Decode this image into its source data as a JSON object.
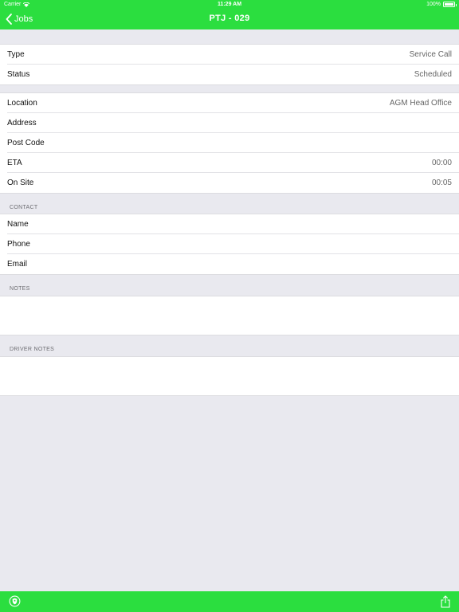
{
  "status_bar": {
    "carrier": "Carrier",
    "time": "11:29 AM",
    "battery": "100%"
  },
  "nav": {
    "back_label": "Jobs",
    "title": "PTJ - 029"
  },
  "job": {
    "type": {
      "label": "Type",
      "value": "Service Call"
    },
    "status": {
      "label": "Status",
      "value": "Scheduled"
    }
  },
  "site": {
    "location": {
      "label": "Location",
      "value": "AGM Head Office"
    },
    "address": {
      "label": "Address",
      "value": ""
    },
    "post_code": {
      "label": "Post Code",
      "value": ""
    },
    "eta": {
      "label": "ETA",
      "value": "00:00"
    },
    "on_site": {
      "label": "On Site",
      "value": "00:05"
    }
  },
  "contact": {
    "header": "CONTACT",
    "name": {
      "label": "Name",
      "value": ""
    },
    "phone": {
      "label": "Phone",
      "value": ""
    },
    "email": {
      "label": "Email",
      "value": ""
    }
  },
  "notes": {
    "header": "NOTES",
    "text": ""
  },
  "driver_notes": {
    "header": "DRIVER NOTES",
    "text": ""
  },
  "toolbar": {
    "left_icon": "shield-icon",
    "right_icon": "share-icon"
  },
  "colors": {
    "accent": "#2bde3f",
    "background": "#e9e9ef"
  }
}
